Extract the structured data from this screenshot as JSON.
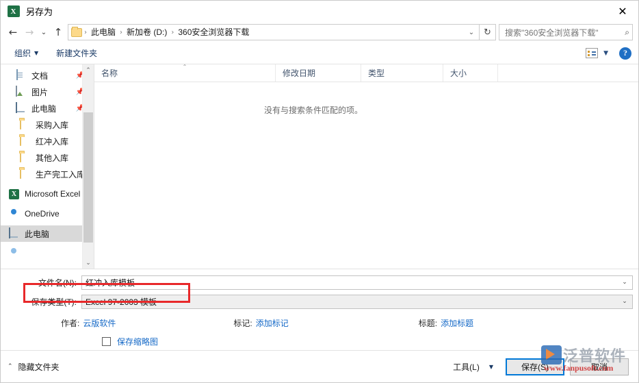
{
  "window": {
    "title": "另存为",
    "app_icon": "excel-icon",
    "close_label": "✕"
  },
  "nav": {
    "back_icon": "←",
    "forward_icon": "→",
    "history_icon": "⌄",
    "up_icon": "↑",
    "refresh_icon": "↻",
    "dropdown_icon": "⌄",
    "breadcrumbs": [
      "此电脑",
      "新加卷 (D:)",
      "360安全浏览器下载"
    ],
    "separator": "›"
  },
  "search": {
    "placeholder": "搜索\"360安全浏览器下载\"",
    "icon": "⌕"
  },
  "toolbar": {
    "organize_label": "组织",
    "organize_caret": "▼",
    "new_folder_label": "新建文件夹",
    "view_caret": "▼",
    "help_label": "?"
  },
  "sidebar": {
    "items": [
      {
        "label": "文档",
        "icon": "document-icon",
        "pinned": true,
        "pin": "📌",
        "level": 1,
        "selected": false
      },
      {
        "label": "图片",
        "icon": "pictures-icon",
        "pinned": true,
        "pin": "📌",
        "level": 1,
        "selected": false
      },
      {
        "label": "此电脑",
        "icon": "computer-icon",
        "pinned": true,
        "pin": "📌",
        "level": 1,
        "selected": false
      },
      {
        "label": "采购入库",
        "icon": "folder-icon",
        "pinned": false,
        "level": 2,
        "selected": false
      },
      {
        "label": "红冲入库",
        "icon": "folder-icon",
        "pinned": false,
        "level": 2,
        "selected": false
      },
      {
        "label": "其他入库",
        "icon": "folder-icon",
        "pinned": false,
        "level": 2,
        "selected": false
      },
      {
        "label": "生产完工入库",
        "icon": "folder-icon",
        "pinned": false,
        "level": 2,
        "selected": false
      },
      {
        "label": "Microsoft Excel",
        "icon": "excel-icon",
        "pinned": false,
        "level": 0,
        "selected": false
      },
      {
        "label": "OneDrive",
        "icon": "onedrive-cloud-icon",
        "pinned": false,
        "level": 0,
        "selected": false
      },
      {
        "label": "此电脑",
        "icon": "computer-icon",
        "pinned": false,
        "level": 0,
        "selected": true
      }
    ],
    "scroll_up_icon": "⌃",
    "scroll_down_icon": "⌄"
  },
  "filelist": {
    "columns": [
      {
        "label": "名称",
        "sorted": true,
        "sort_caret": "⌃"
      },
      {
        "label": "修改日期",
        "sorted": false
      },
      {
        "label": "类型",
        "sorted": false
      },
      {
        "label": "大小",
        "sorted": false
      }
    ],
    "rows": [],
    "empty_message": "没有与搜索条件匹配的项。"
  },
  "form": {
    "filename_label": "文件名(N):",
    "filename_value": "红冲入库模板",
    "filetype_label": "保存类型(T):",
    "filetype_value": "Excel 97-2003 模板",
    "combo_arrow": "⌄",
    "meta": [
      {
        "key": "作者:",
        "value": "云版软件"
      },
      {
        "key": "标记:",
        "value": "添加标记"
      },
      {
        "key": "标题:",
        "value": "添加标题"
      }
    ],
    "thumbnail_label": "保存缩略图",
    "thumbnail_checked": false
  },
  "footer": {
    "hide_folders_label": "隐藏文件夹",
    "hide_folders_caret": "⌃",
    "tools_label": "工具(L)",
    "tools_caret": "▼",
    "save_label": "保存(S)",
    "cancel_label": "取消"
  },
  "watermark": {
    "brand": "泛普软件",
    "url": "www.fanpusoft.com"
  },
  "colors": {
    "accent": "#0078d7",
    "link": "#1569c7",
    "annotation": "#e8282a",
    "excel_green": "#1e7145",
    "selection": "#d9d9d9"
  }
}
